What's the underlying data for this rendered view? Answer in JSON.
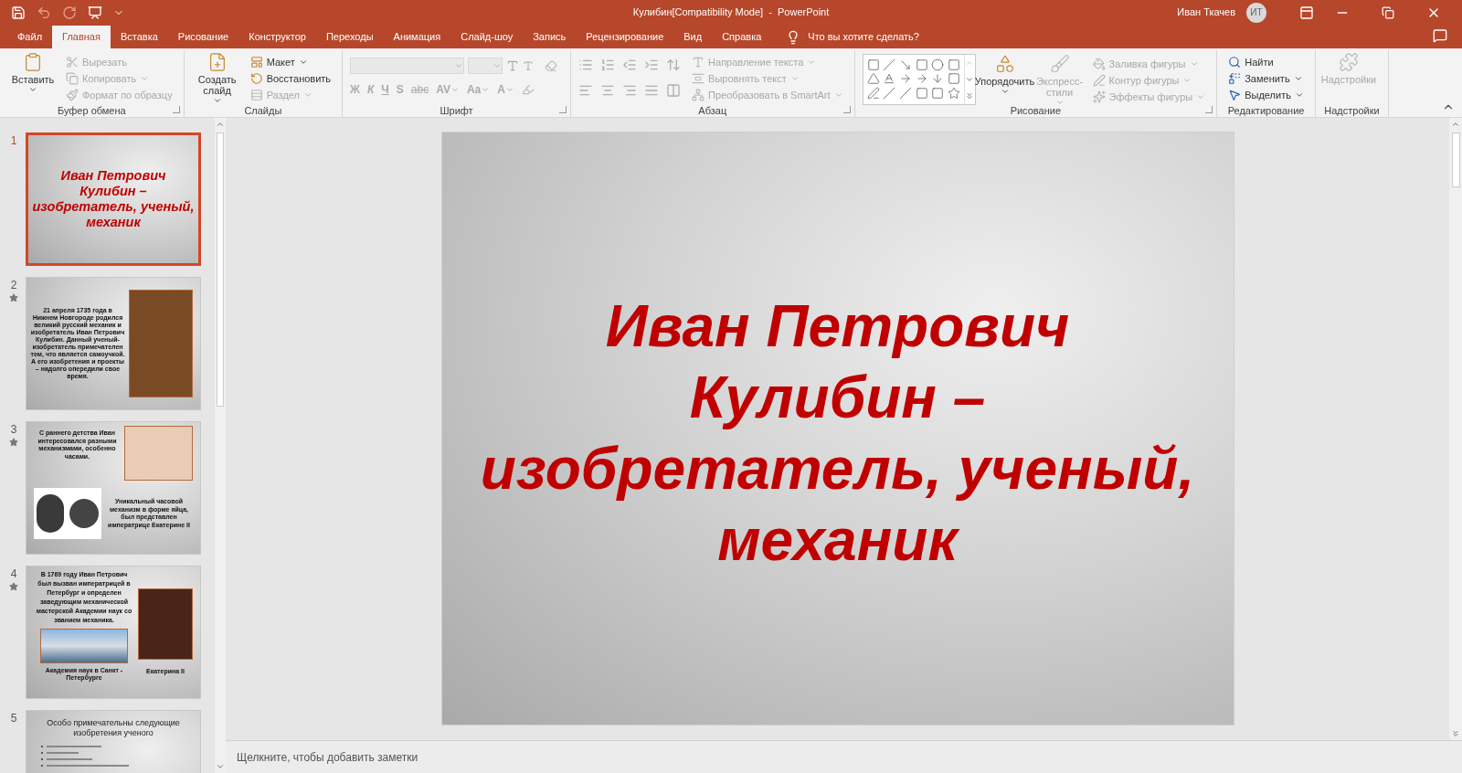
{
  "window": {
    "title": "Кулибин[Compatibility Mode]  -  PowerPoint",
    "user": "Иван Ткачев",
    "user_initials": "ИТ"
  },
  "tabs": [
    {
      "label": "Файл",
      "selected": false
    },
    {
      "label": "Главная",
      "selected": true
    },
    {
      "label": "Вставка",
      "selected": false
    },
    {
      "label": "Рисование",
      "selected": false
    },
    {
      "label": "Конструктор",
      "selected": false
    },
    {
      "label": "Переходы",
      "selected": false
    },
    {
      "label": "Анимация",
      "selected": false
    },
    {
      "label": "Слайд-шоу",
      "selected": false
    },
    {
      "label": "Запись",
      "selected": false
    },
    {
      "label": "Рецензирование",
      "selected": false
    },
    {
      "label": "Вид",
      "selected": false
    },
    {
      "label": "Справка",
      "selected": false
    }
  ],
  "tell_me": "Что вы хотите сделать?",
  "ribbon": [
    {
      "label": "Буфер обмена",
      "launcher": true,
      "items": [
        {
          "label": "Вставить",
          "kind": "large",
          "disabled": false,
          "menu": true
        },
        {
          "label": "Вырезать",
          "kind": "small",
          "disabled": true,
          "menu": false
        },
        {
          "label": "Копировать",
          "kind": "small",
          "disabled": true,
          "menu": true
        },
        {
          "label": "Формат по образцу",
          "kind": "small",
          "disabled": true,
          "menu": false
        }
      ]
    },
    {
      "label": "Слайды",
      "launcher": false,
      "items": [
        {
          "label": "Создать слайд",
          "kind": "large",
          "disabled": false,
          "menu": true
        },
        {
          "label": "Макет",
          "kind": "small",
          "disabled": false,
          "menu": true
        },
        {
          "label": "Восстановить",
          "kind": "small",
          "disabled": false,
          "menu": false
        },
        {
          "label": "Раздел",
          "kind": "small",
          "disabled": true,
          "menu": true
        }
      ]
    },
    {
      "label": "Шрифт",
      "launcher": true,
      "items": [
        {
          "label": "Ж",
          "kind": "format",
          "disabled": true,
          "menu": false
        },
        {
          "label": "К",
          "kind": "format",
          "disabled": true,
          "menu": false
        },
        {
          "label": "Ч",
          "kind": "format",
          "disabled": true,
          "menu": false
        },
        {
          "label": "S",
          "kind": "format",
          "disabled": true,
          "menu": false
        },
        {
          "label": "abc",
          "kind": "format",
          "disabled": true,
          "menu": false
        },
        {
          "label": "AV",
          "kind": "format",
          "disabled": true,
          "menu": true
        },
        {
          "label": "Aa",
          "kind": "format",
          "disabled": true,
          "menu": true
        },
        {
          "label": "A",
          "kind": "format",
          "disabled": true,
          "menu": true
        }
      ]
    },
    {
      "label": "Абзац",
      "launcher": true,
      "items": [
        {
          "label": "Направление текста",
          "kind": "small",
          "disabled": true,
          "menu": true
        },
        {
          "label": "Выровнять текст",
          "kind": "small",
          "disabled": true,
          "menu": true
        },
        {
          "label": "Преобразовать в SmartArt",
          "kind": "small",
          "disabled": true,
          "menu": true
        }
      ]
    },
    {
      "label": "Рисование",
      "launcher": true,
      "items": [
        {
          "label": "Упорядочить",
          "kind": "large",
          "disabled": false,
          "menu": true
        },
        {
          "label": "Экспресс-стили",
          "kind": "large",
          "disabled": true,
          "menu": true
        },
        {
          "label": "Заливка фигуры",
          "kind": "small",
          "disabled": true,
          "menu": true
        },
        {
          "label": "Контур фигуры",
          "kind": "small",
          "disabled": true,
          "menu": true
        },
        {
          "label": "Эффекты фигуры",
          "kind": "small",
          "disabled": true,
          "menu": true
        }
      ]
    },
    {
      "label": "Редактирование",
      "launcher": false,
      "items": [
        {
          "label": "Найти",
          "kind": "small",
          "disabled": false,
          "menu": false
        },
        {
          "label": "Заменить",
          "kind": "small",
          "disabled": false,
          "menu": true
        },
        {
          "label": "Выделить",
          "kind": "small",
          "disabled": false,
          "menu": true
        }
      ]
    },
    {
      "label": "Надстройки",
      "launcher": false,
      "items": [
        {
          "label": "Надстройки",
          "kind": "large",
          "disabled": true,
          "menu": false
        }
      ]
    }
  ],
  "slides": [
    {
      "number": "1",
      "selected": true,
      "animated": false,
      "kind": "title",
      "texts": [
        "Иван Петрович Кулибин – изобретатель, ученый, механик"
      ]
    },
    {
      "number": "2",
      "selected": false,
      "animated": true,
      "kind": "text-photo",
      "texts": [
        "21 апреля 1735 года в Нижнем Новгороде родился великий русский механик и изобретатель Иван Петрович Кулибин. Данный ученый-изобретатель примечателен тем, что является самоучкой. А его изобретения и проекты – надолго опередили свое время."
      ]
    },
    {
      "number": "3",
      "selected": false,
      "animated": true,
      "kind": "two-photos",
      "texts": [
        "С раннего детства Иван интересовался разными механизмами, особенно часами.",
        "Уникальный часовой механизм в форме яйца, был представлен императрице Екатерине II"
      ]
    },
    {
      "number": "4",
      "selected": false,
      "animated": true,
      "kind": "captioned-photos",
      "texts": [
        "В 1769 году Иван Петрович был вызван императрицей в Петербург и определен заведующим механической мастерской Академии наук со званием механика.",
        "Академия наук в Санкт - Петербурге",
        "Екатерина II"
      ]
    },
    {
      "number": "5",
      "selected": false,
      "animated": false,
      "kind": "list",
      "texts": [
        "Особо примечательны следующие изобретения ученого"
      ]
    }
  ],
  "editor": {
    "title_lines": [
      "Иван Петрович",
      "Кулибин –",
      "изобретатель, ученый,",
      "механик"
    ]
  },
  "notes": {
    "placeholder": "Щелкните, чтобы добавить заметки"
  }
}
